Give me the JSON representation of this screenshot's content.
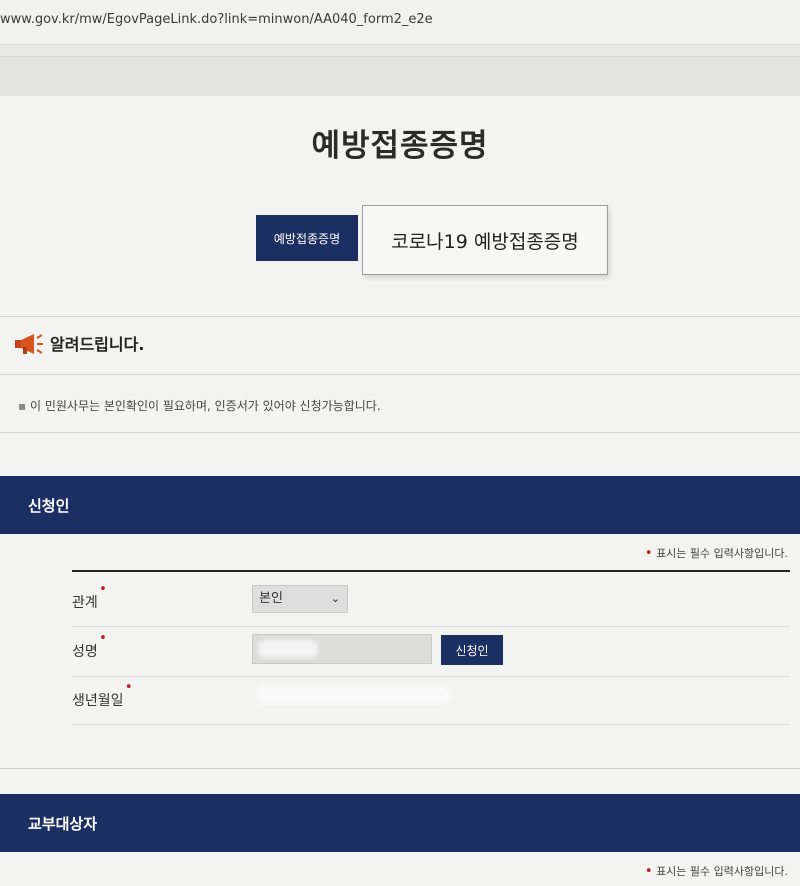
{
  "browser": {
    "url": "www.gov.kr/mw/EgovPageLink.do?link=minwon/AA040_form2_e2e"
  },
  "page": {
    "title": "예방접종증명"
  },
  "tabs": {
    "active_label": "예방접종증명",
    "popup_label": "코로나19 예방접종증명"
  },
  "notice": {
    "icon": "megaphone-icon",
    "title": "알려드립니다.",
    "text": "이 민원사무는 본인확인이 필요하며, 인증서가 있어야 신청가능합니다."
  },
  "applicant_section": {
    "title": "신청인",
    "required_note": "표시는 필수 입력사항입니다.",
    "relation_label": "관계",
    "relation_value": "본인",
    "name_label": "성명",
    "name_button": "신청인",
    "birth_label": "생년월일"
  },
  "recipient_section": {
    "title": "교부대상자",
    "required_note": "표시는 필수 입력사항입니다."
  },
  "colors": {
    "navy": "#1b2f63",
    "required_star": "#c0182a"
  }
}
